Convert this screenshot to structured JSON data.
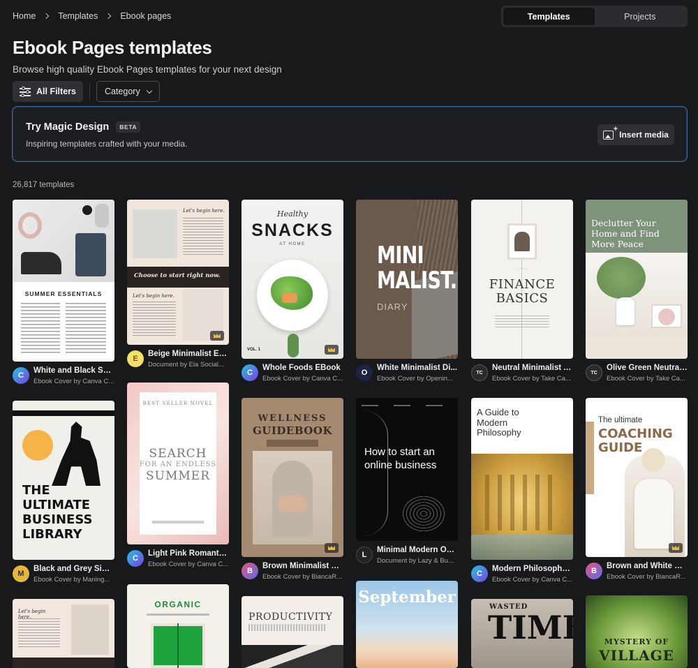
{
  "breadcrumb": [
    "Home",
    "Templates",
    "Ebook pages"
  ],
  "toggle": {
    "templates": "Templates",
    "projects": "Projects"
  },
  "page": {
    "title": "Ebook Pages templates",
    "subtitle": "Browse high quality Ebook Pages templates for your next design"
  },
  "filters": {
    "all": "All Filters",
    "category": "Category"
  },
  "magic": {
    "title": "Try Magic Design",
    "badge": "BETA",
    "subtitle": "Inspiring templates crafted with your media.",
    "button": "Insert media"
  },
  "count": "26,817 templates",
  "colors": {
    "accent": "#3d6aa6",
    "background": "#18191b",
    "crown": "#f5b935"
  },
  "templates": [
    {
      "title": "White and Black Su...",
      "subtitle": "Ebook Cover by Canva C...",
      "thumb": {
        "line1": "SUMMER ESSENTIALS"
      }
    },
    {
      "title": "Black and Grey Sim...",
      "subtitle": "Ebook Cover by Maning...",
      "thumb": {
        "line1": "THE",
        "line2": "ULTIMATE",
        "line3": "BUSINESS",
        "line4": "LIBRARY"
      }
    },
    {
      "title": "Beige Minimalist Eb...",
      "subtitle": "Document by Ela Social...",
      "thumb": {
        "line1": "Let's begin here.",
        "line2": "Choose to start right now.",
        "line3": "Let's begin here."
      }
    },
    {
      "title": "Light Pink Romantic ...",
      "subtitle": "Ebook Cover by Canva C...",
      "thumb": {
        "line1": "BEST SELLER NOVEL",
        "line2": "SEARCH",
        "line3": "FOR AN ENDLESS",
        "line4": "SUMMER"
      }
    },
    {
      "title": "",
      "subtitle": "",
      "thumb": {
        "line1": "ORGANIC"
      }
    },
    {
      "title": "Whole Foods EBook",
      "subtitle": "Ebook Cover by Canva C...",
      "thumb": {
        "line1": "Healthy",
        "line2": "SNACKS",
        "line3": "AT HOME",
        "line4": "VOL. 1"
      }
    },
    {
      "title": "Brown Minimalist W...",
      "subtitle": "Ebook Cover by BiancaR...",
      "thumb": {
        "line1": "WELLNESS",
        "line2": "GUIDEBOOK"
      }
    },
    {
      "title": "",
      "subtitle": "",
      "thumb": {
        "line1": "PRODUCTIVITY"
      }
    },
    {
      "title": "White Minimalist Di...",
      "subtitle": "Ebook Cover by Openin...",
      "thumb": {
        "line1": "MINI",
        "line2": "MALIST.",
        "line3": "DIARY"
      }
    },
    {
      "title": "Minimal Modern Onl...",
      "subtitle": "Document by Lazy & Bu...",
      "thumb": {
        "line1": "How to start an",
        "line2": "online business"
      }
    },
    {
      "title": "",
      "subtitle": "",
      "thumb": {
        "line1": "September"
      }
    },
    {
      "title": "Neutral Minimalist A...",
      "subtitle": "Ebook Cover by Take Ca...",
      "thumb": {
        "line1": "FINANCE",
        "line2": "BASICS"
      }
    },
    {
      "title": "Modern Philosophy ...",
      "subtitle": "Ebook Cover by Canva C...",
      "thumb": {
        "line1": "A Guide to",
        "line2": "Modern",
        "line3": "Philosophy"
      }
    },
    {
      "title": "",
      "subtitle": "",
      "thumb": {
        "line1": "WASTED",
        "line2": "TIME"
      }
    },
    {
      "title": "Olive Green Neutral ...",
      "subtitle": "Ebook Cover by Take Ca...",
      "thumb": {
        "line1": "Declutter Your",
        "line2": "Home and Find",
        "line3": "More Peace"
      }
    },
    {
      "title": "Brown and White Mi...",
      "subtitle": "Ebook Cover by BiancaR...",
      "thumb": {
        "line1": "The ultimate",
        "line2": "COACHING",
        "line3": "GUIDE"
      }
    },
    {
      "title": "",
      "subtitle": "",
      "thumb": {
        "line1": "MYSTERY OF",
        "line2": "VILLAGE"
      }
    }
  ]
}
